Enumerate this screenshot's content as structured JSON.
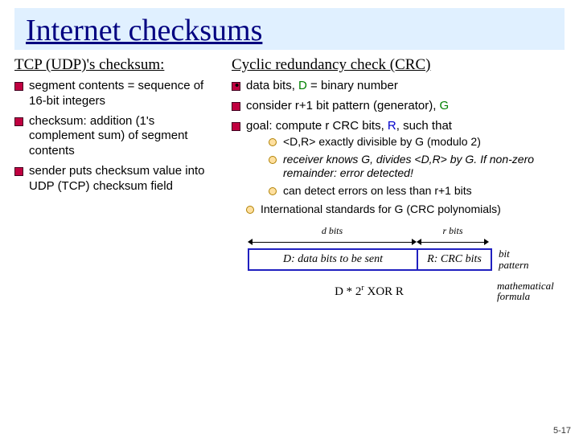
{
  "title": "Internet checksums",
  "left": {
    "heading": "TCP (UDP)'s checksum:",
    "items": [
      "segment contents = sequence of 16-bit integers",
      "checksum: addition (1's complement sum) of segment contents",
      "sender puts checksum value into UDP (TCP) checksum field"
    ]
  },
  "right": {
    "heading": "Cyclic redundancy check (CRC)",
    "b1_pre": "data bits, ",
    "b1_D": "D",
    "b1_post": " = binary number",
    "b2_pre": "consider r+1 bit pattern (generator), ",
    "b2_G": "G",
    "b3_pre": "goal: compute r CRC bits, ",
    "b3_R": "R",
    "b3_post": ", such that",
    "sub": [
      "<D,R> exactly divisible by G (modulo 2)",
      "receiver knows G, divides <D,R> by G. If non-zero remainder: error detected!",
      "can detect errors on less than r+1 bits"
    ],
    "b4": "International standards for G (CRC polynomials)"
  },
  "diagram": {
    "d_bits": "d bits",
    "r_bits": "r bits",
    "box_d": "D: data bits to be sent",
    "box_r": "R: CRC bits",
    "bit_pattern": "bit\npattern",
    "formula_d": "D * 2",
    "formula_exp": "r",
    "formula_rest": "   XOR   R",
    "math_label": "mathematical\nformula"
  },
  "page": "5-17"
}
